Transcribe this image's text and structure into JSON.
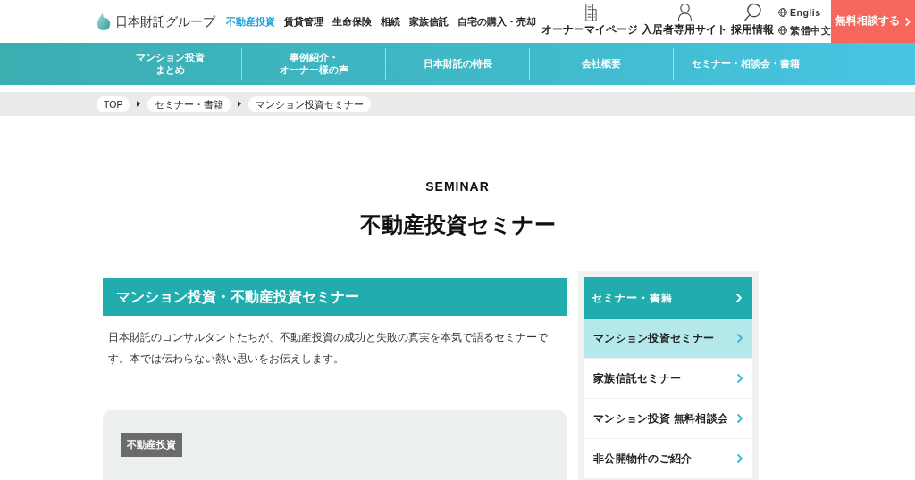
{
  "header": {
    "logo": "日本財託グループ",
    "nav": [
      {
        "label": "不動産投資",
        "selected": true
      },
      {
        "label": "賃貸管理",
        "selected": false
      },
      {
        "label": "生命保険",
        "selected": false
      },
      {
        "label": "相続",
        "selected": false
      },
      {
        "label": "家族信託",
        "selected": false
      },
      {
        "label": "自宅の購入・売却",
        "selected": false
      }
    ],
    "utility_links": [
      {
        "kind": "building",
        "label": "オーナーマイページ"
      },
      {
        "kind": "person",
        "label": "入居者専用サイト"
      },
      {
        "kind": "search",
        "label": "採用情報"
      }
    ],
    "languages": [
      "Englis",
      "繁體中文"
    ],
    "cta": "無料相談する"
  },
  "sub_nav": [
    {
      "lines": [
        "マンション投資",
        "まとめ"
      ]
    },
    {
      "lines": [
        "事例紹介・",
        "オーナー様の声"
      ]
    },
    {
      "lines": [
        "日本財託の特長"
      ]
    },
    {
      "lines": [
        "会社概要"
      ]
    },
    {
      "lines": [
        "セミナー・相談会・書籍"
      ]
    }
  ],
  "breadcrumb": [
    "TOP",
    "セミナー・書籍",
    "マンション投資セミナー"
  ],
  "page_title": {
    "eyebrow": "SEMINAR",
    "title": "不動産投資セミナー"
  },
  "main": {
    "heading": "マンション投資・不動産投資セミナー",
    "intro": "日本財託のコンサルタントたちが、不動産投資の成功と失敗の真実を本気で語るセミナーです。本では伝わらない熱い思いをお伝えします。",
    "card": {
      "tag": "不動産投資"
    }
  },
  "sidebar": {
    "heading": "セミナー・書籍",
    "items": [
      {
        "label": "マンション投資セミナー",
        "selected": true
      },
      {
        "label": "家族信託セミナー",
        "selected": false
      },
      {
        "label": "マンション投資 無料相談会",
        "selected": false
      },
      {
        "label": "非公開物件のご紹介",
        "selected": false
      }
    ]
  }
}
